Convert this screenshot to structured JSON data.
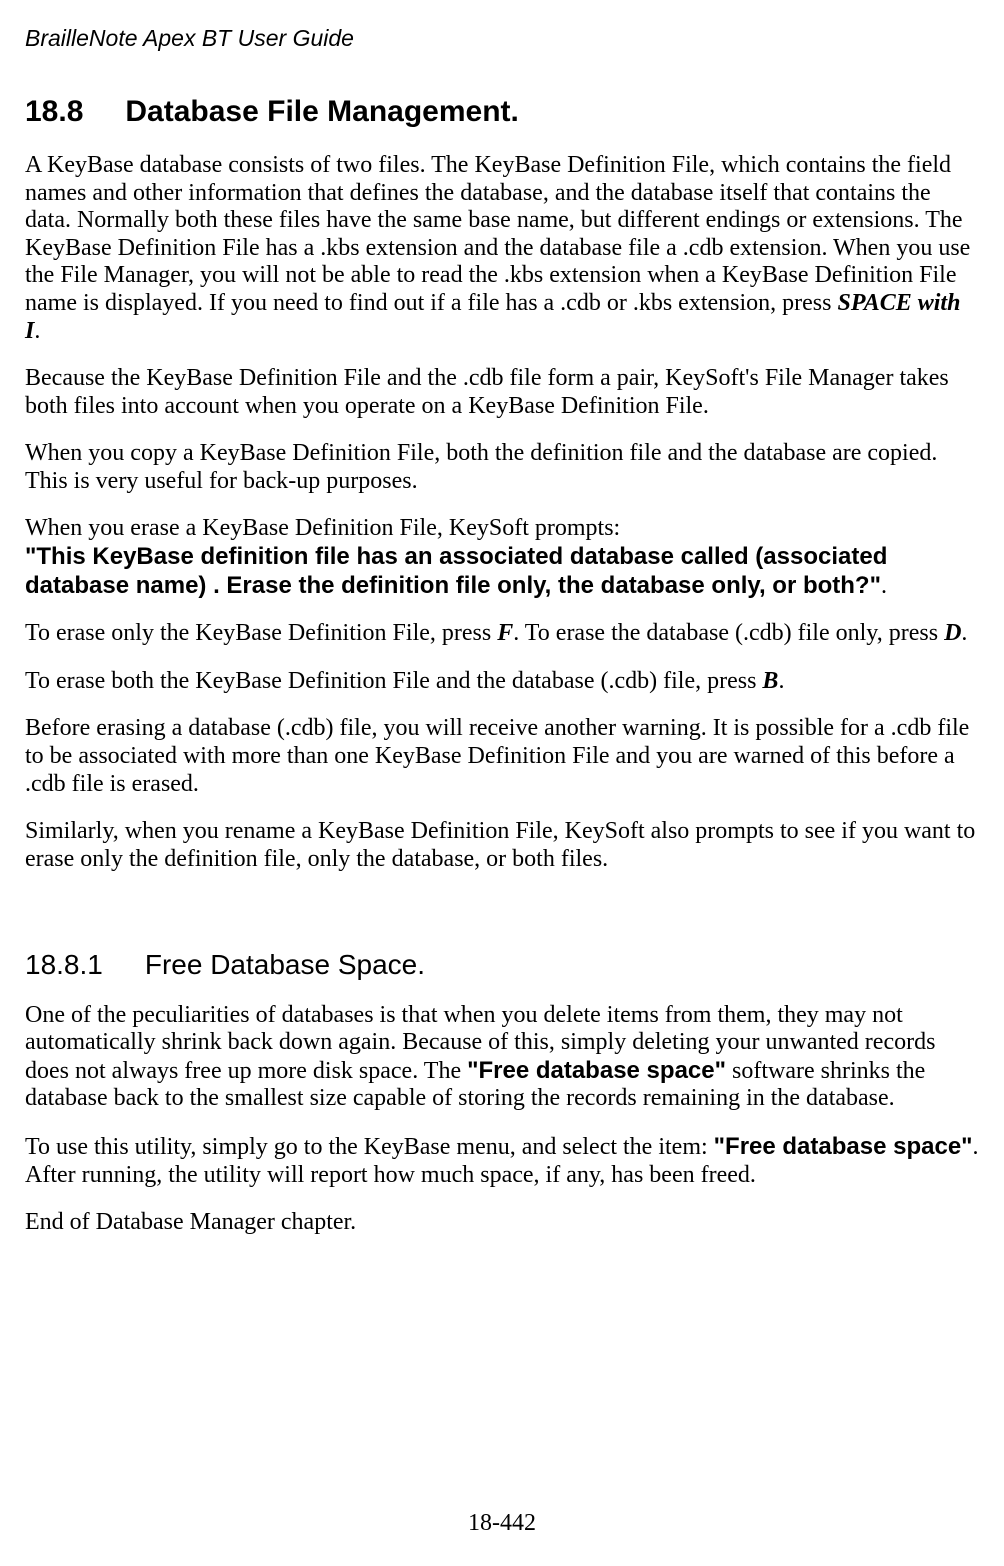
{
  "header": "BrailleNote Apex BT User Guide",
  "footer": "18-442",
  "section_18_8": {
    "number": "18.8",
    "title": "Database File Management.",
    "p1_text_pre": "A KeyBase database consists of two files. The KeyBase Definition File, which contains the field names and other information that defines the database, and the database itself that contains the data. Normally both these files have the same base name, but different endings or extensions. The KeyBase Definition File has a .kbs extension and the database file a .cdb extension. When you use the File Manager, you will not be able to read the .kbs extension when a KeyBase Definition File name is displayed. If you need to find out if a file has a .cdb or .kbs extension, press ",
    "p1_emph": "SPACE with I",
    "p1_text_post": ".",
    "p2": "Because the KeyBase Definition File and the .cdb file form a pair, KeySoft's File Manager takes both files into account when you operate on a KeyBase Definition File.",
    "p3": "When you copy a KeyBase Definition File, both the definition file and the database are copied. This is very useful for back-up purposes.",
    "p4_line1": "When you erase a KeyBase Definition File, KeySoft prompts:",
    "p4_sans_a": "\"This KeyBase definition file has an associated database called (associated database name) . Erase the definition file only, the database only, or both?\"",
    "p4_post": ".",
    "p5_pre": "To erase only the KeyBase Definition File, press ",
    "p5_emph1": "F",
    "p5_mid": ". To erase the database (.cdb) file only, press ",
    "p5_emph2": "D",
    "p5_post": ".",
    "p6_pre": "To erase both the KeyBase Definition File and the database (.cdb) file, press ",
    "p6_emph": "B",
    "p6_post": ".",
    "p7": "Before erasing a database (.cdb) file, you will receive another warning. It is possible for a .cdb file to be associated with more than one KeyBase Definition File and you are warned of this before a .cdb file is erased.",
    "p8": "Similarly, when you rename a KeyBase Definition File, KeySoft also prompts to see if you want to erase only the definition file, only the database, or both files."
  },
  "section_18_8_1": {
    "number": "18.8.1",
    "title": "Free Database Space.",
    "p1_pre": "One of the peculiarities of databases is that when you delete items from them, they may not automatically shrink back down again. Because of this, simply deleting your unwanted records does not always free up more disk space. The ",
    "p1_sans": "\"Free database space\"",
    "p1_post": " software shrinks the database back to the smallest size capable of storing the records remaining in the database.",
    "p2_pre": "To use this utility, simply go to the KeyBase menu, and select the item: ",
    "p2_sans": "\"Free database space\"",
    "p2_post": ". After running, the utility will report how much space, if any, has been freed.",
    "p3": "End of Database Manager chapter."
  }
}
